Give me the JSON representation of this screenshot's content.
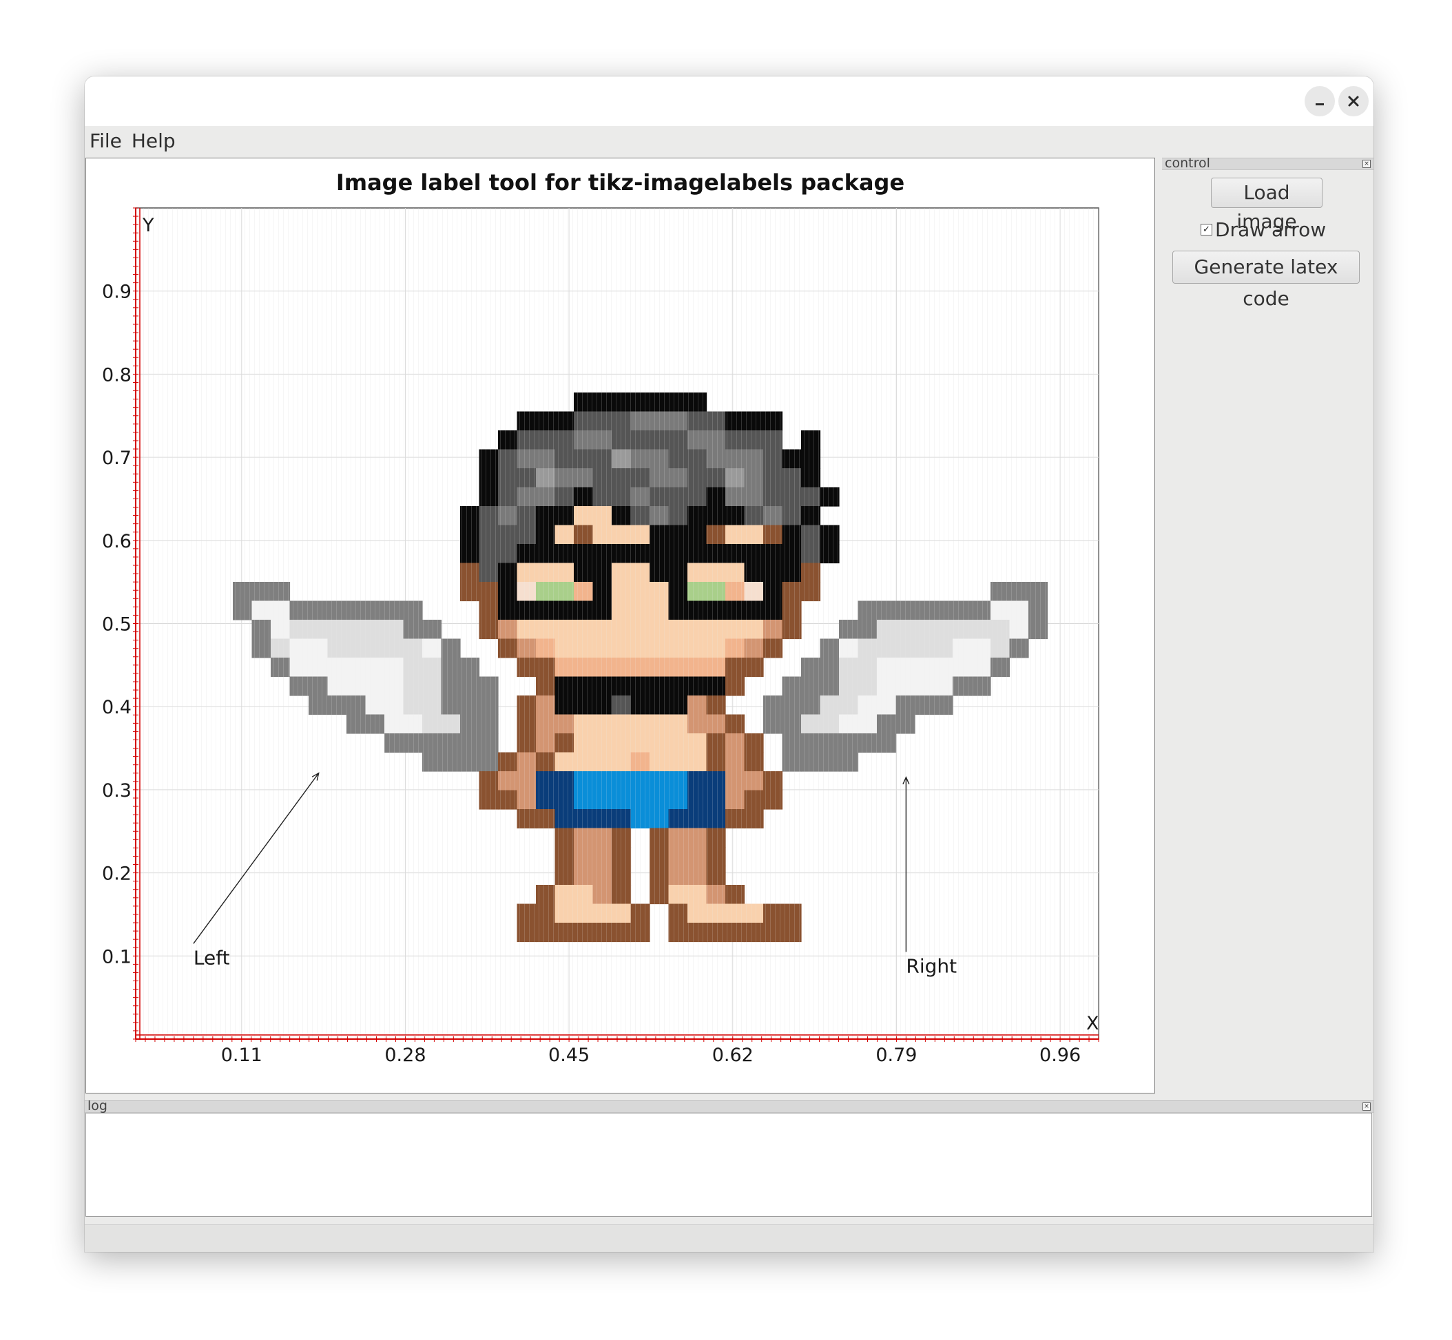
{
  "menu": {
    "file": "File",
    "help": "Help"
  },
  "plot": {
    "title": "Image label tool for tikz-imagelabels package",
    "y_axis_label": "Y",
    "x_axis_label": "X",
    "x_ticks": [
      "0.11",
      "0.28",
      "0.45",
      "0.62",
      "0.79",
      "0.96"
    ],
    "y_ticks": [
      "0.9",
      "0.8",
      "0.7",
      "0.6",
      "0.5",
      "0.4",
      "0.3",
      "0.2",
      "0.1"
    ],
    "annotations": [
      {
        "text": "Left",
        "label_x": 0.06,
        "label_y": 0.1,
        "arrow_to_x": 0.19,
        "arrow_to_y": 0.32
      },
      {
        "text": "Right",
        "label_x": 0.8,
        "label_y": 0.09,
        "arrow_to_x": 0.8,
        "arrow_to_y": 0.315
      }
    ],
    "image_subject": "pixel-art angel character with glasses and white-gray wings"
  },
  "control": {
    "title": "control",
    "load_image": "Load image",
    "draw_arrow": "Draw arrow",
    "draw_arrow_checked": true,
    "generate_latex": "Generate latex code"
  },
  "log": {
    "title": "log",
    "content": ""
  },
  "colors": {
    "axis_red": "#d40000",
    "grid": "#e6e6e6",
    "panel_bg": "#ebebea"
  }
}
